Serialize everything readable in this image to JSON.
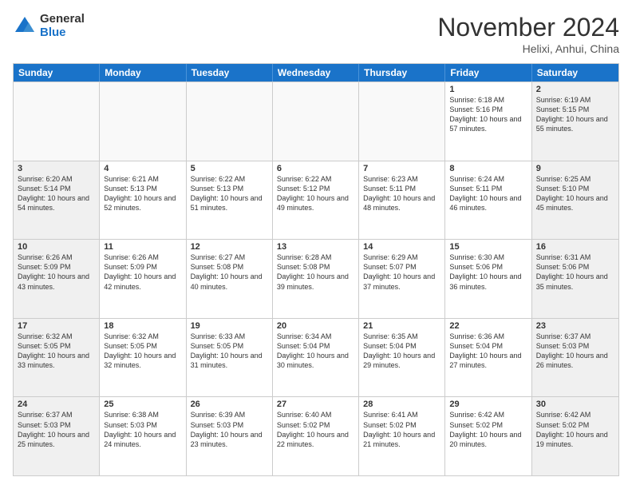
{
  "logo": {
    "general": "General",
    "blue": "Blue"
  },
  "title": "November 2024",
  "location": "Helixi, Anhui, China",
  "days": [
    "Sunday",
    "Monday",
    "Tuesday",
    "Wednesday",
    "Thursday",
    "Friday",
    "Saturday"
  ],
  "weeks": [
    [
      {
        "day": "",
        "empty": true
      },
      {
        "day": "",
        "empty": true
      },
      {
        "day": "",
        "empty": true
      },
      {
        "day": "",
        "empty": true
      },
      {
        "day": "",
        "empty": true
      },
      {
        "day": "1",
        "sunrise": "6:18 AM",
        "sunset": "5:16 PM",
        "daylight": "10 hours and 57 minutes."
      },
      {
        "day": "2",
        "sunrise": "6:19 AM",
        "sunset": "5:15 PM",
        "daylight": "10 hours and 55 minutes."
      }
    ],
    [
      {
        "day": "3",
        "sunrise": "6:20 AM",
        "sunset": "5:14 PM",
        "daylight": "10 hours and 54 minutes."
      },
      {
        "day": "4",
        "sunrise": "6:21 AM",
        "sunset": "5:13 PM",
        "daylight": "10 hours and 52 minutes."
      },
      {
        "day": "5",
        "sunrise": "6:22 AM",
        "sunset": "5:13 PM",
        "daylight": "10 hours and 51 minutes."
      },
      {
        "day": "6",
        "sunrise": "6:22 AM",
        "sunset": "5:12 PM",
        "daylight": "10 hours and 49 minutes."
      },
      {
        "day": "7",
        "sunrise": "6:23 AM",
        "sunset": "5:11 PM",
        "daylight": "10 hours and 48 minutes."
      },
      {
        "day": "8",
        "sunrise": "6:24 AM",
        "sunset": "5:11 PM",
        "daylight": "10 hours and 46 minutes."
      },
      {
        "day": "9",
        "sunrise": "6:25 AM",
        "sunset": "5:10 PM",
        "daylight": "10 hours and 45 minutes."
      }
    ],
    [
      {
        "day": "10",
        "sunrise": "6:26 AM",
        "sunset": "5:09 PM",
        "daylight": "10 hours and 43 minutes."
      },
      {
        "day": "11",
        "sunrise": "6:26 AM",
        "sunset": "5:09 PM",
        "daylight": "10 hours and 42 minutes."
      },
      {
        "day": "12",
        "sunrise": "6:27 AM",
        "sunset": "5:08 PM",
        "daylight": "10 hours and 40 minutes."
      },
      {
        "day": "13",
        "sunrise": "6:28 AM",
        "sunset": "5:08 PM",
        "daylight": "10 hours and 39 minutes."
      },
      {
        "day": "14",
        "sunrise": "6:29 AM",
        "sunset": "5:07 PM",
        "daylight": "10 hours and 37 minutes."
      },
      {
        "day": "15",
        "sunrise": "6:30 AM",
        "sunset": "5:06 PM",
        "daylight": "10 hours and 36 minutes."
      },
      {
        "day": "16",
        "sunrise": "6:31 AM",
        "sunset": "5:06 PM",
        "daylight": "10 hours and 35 minutes."
      }
    ],
    [
      {
        "day": "17",
        "sunrise": "6:32 AM",
        "sunset": "5:05 PM",
        "daylight": "10 hours and 33 minutes."
      },
      {
        "day": "18",
        "sunrise": "6:32 AM",
        "sunset": "5:05 PM",
        "daylight": "10 hours and 32 minutes."
      },
      {
        "day": "19",
        "sunrise": "6:33 AM",
        "sunset": "5:05 PM",
        "daylight": "10 hours and 31 minutes."
      },
      {
        "day": "20",
        "sunrise": "6:34 AM",
        "sunset": "5:04 PM",
        "daylight": "10 hours and 30 minutes."
      },
      {
        "day": "21",
        "sunrise": "6:35 AM",
        "sunset": "5:04 PM",
        "daylight": "10 hours and 29 minutes."
      },
      {
        "day": "22",
        "sunrise": "6:36 AM",
        "sunset": "5:04 PM",
        "daylight": "10 hours and 27 minutes."
      },
      {
        "day": "23",
        "sunrise": "6:37 AM",
        "sunset": "5:03 PM",
        "daylight": "10 hours and 26 minutes."
      }
    ],
    [
      {
        "day": "24",
        "sunrise": "6:37 AM",
        "sunset": "5:03 PM",
        "daylight": "10 hours and 25 minutes."
      },
      {
        "day": "25",
        "sunrise": "6:38 AM",
        "sunset": "5:03 PM",
        "daylight": "10 hours and 24 minutes."
      },
      {
        "day": "26",
        "sunrise": "6:39 AM",
        "sunset": "5:03 PM",
        "daylight": "10 hours and 23 minutes."
      },
      {
        "day": "27",
        "sunrise": "6:40 AM",
        "sunset": "5:02 PM",
        "daylight": "10 hours and 22 minutes."
      },
      {
        "day": "28",
        "sunrise": "6:41 AM",
        "sunset": "5:02 PM",
        "daylight": "10 hours and 21 minutes."
      },
      {
        "day": "29",
        "sunrise": "6:42 AM",
        "sunset": "5:02 PM",
        "daylight": "10 hours and 20 minutes."
      },
      {
        "day": "30",
        "sunrise": "6:42 AM",
        "sunset": "5:02 PM",
        "daylight": "10 hours and 19 minutes."
      }
    ]
  ]
}
